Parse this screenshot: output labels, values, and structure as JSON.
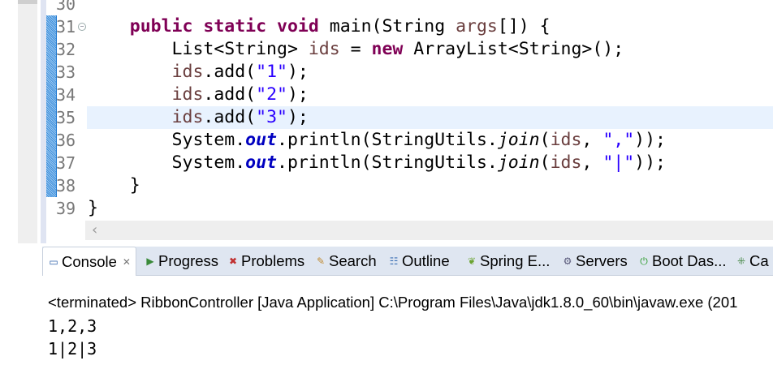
{
  "editor": {
    "line_numbers": [
      "30",
      "31",
      "32",
      "33",
      "34",
      "35",
      "36",
      "37",
      "38",
      "39"
    ],
    "current_line": "35",
    "lines": [
      {
        "n": "30",
        "segments": []
      },
      {
        "n": "31",
        "segments": [
          {
            "t": "    "
          },
          {
            "t": "public",
            "c": "kw"
          },
          {
            "t": " "
          },
          {
            "t": "static",
            "c": "kw"
          },
          {
            "t": " "
          },
          {
            "t": "void",
            "c": "kw"
          },
          {
            "t": " main(String "
          },
          {
            "t": "args",
            "c": "var"
          },
          {
            "t": "[]) {"
          }
        ]
      },
      {
        "n": "32",
        "segments": [
          {
            "t": "        List<String> "
          },
          {
            "t": "ids",
            "c": "var"
          },
          {
            "t": " = "
          },
          {
            "t": "new",
            "c": "kw"
          },
          {
            "t": " ArrayList<String>();"
          }
        ]
      },
      {
        "n": "33",
        "segments": [
          {
            "t": "        "
          },
          {
            "t": "ids",
            "c": "var"
          },
          {
            "t": ".add("
          },
          {
            "t": "\"1\"",
            "c": "str"
          },
          {
            "t": ");"
          }
        ]
      },
      {
        "n": "34",
        "segments": [
          {
            "t": "        "
          },
          {
            "t": "ids",
            "c": "var"
          },
          {
            "t": ".add("
          },
          {
            "t": "\"2\"",
            "c": "str"
          },
          {
            "t": ");"
          }
        ]
      },
      {
        "n": "35",
        "segments": [
          {
            "t": "        "
          },
          {
            "t": "ids",
            "c": "var"
          },
          {
            "t": ".add("
          },
          {
            "t": "\"3\"",
            "c": "str"
          },
          {
            "t": ");"
          }
        ]
      },
      {
        "n": "36",
        "segments": [
          {
            "t": "        System."
          },
          {
            "t": "out",
            "c": "fld"
          },
          {
            "t": ".println(StringUtils."
          },
          {
            "t": "join",
            "c": "it"
          },
          {
            "t": "("
          },
          {
            "t": "ids",
            "c": "var"
          },
          {
            "t": ", "
          },
          {
            "t": "\",\"",
            "c": "str"
          },
          {
            "t": "));"
          }
        ]
      },
      {
        "n": "37",
        "segments": [
          {
            "t": "        System."
          },
          {
            "t": "out",
            "c": "fld"
          },
          {
            "t": ".println(StringUtils."
          },
          {
            "t": "join",
            "c": "it"
          },
          {
            "t": "("
          },
          {
            "t": "ids",
            "c": "var"
          },
          {
            "t": ", "
          },
          {
            "t": "\"|\"",
            "c": "str"
          },
          {
            "t": "));"
          }
        ]
      },
      {
        "n": "38",
        "segments": [
          {
            "t": "    }"
          }
        ]
      },
      {
        "n": "39",
        "segments": [
          {
            "t": "}"
          }
        ]
      }
    ]
  },
  "tabs": [
    {
      "label": "Console",
      "icon": "console-icon",
      "active": true
    },
    {
      "label": "Progress",
      "icon": "progress-icon"
    },
    {
      "label": "Problems",
      "icon": "problems-icon"
    },
    {
      "label": "Search",
      "icon": "search-icon"
    },
    {
      "label": "Outline",
      "icon": "outline-icon"
    },
    {
      "label": "Spring E...",
      "icon": "spring-explorer-icon"
    },
    {
      "label": "Servers",
      "icon": "servers-icon"
    },
    {
      "label": "Boot Das...",
      "icon": "boot-dashboard-icon"
    },
    {
      "label": "Ca",
      "icon": "call-hierarchy-icon"
    }
  ],
  "console": {
    "header": "<terminated> RibbonController [Java Application] C:\\Program Files\\Java\\jdk1.8.0_60\\bin\\javaw.exe (201",
    "output": [
      "1,2,3",
      "1|2|3"
    ]
  }
}
